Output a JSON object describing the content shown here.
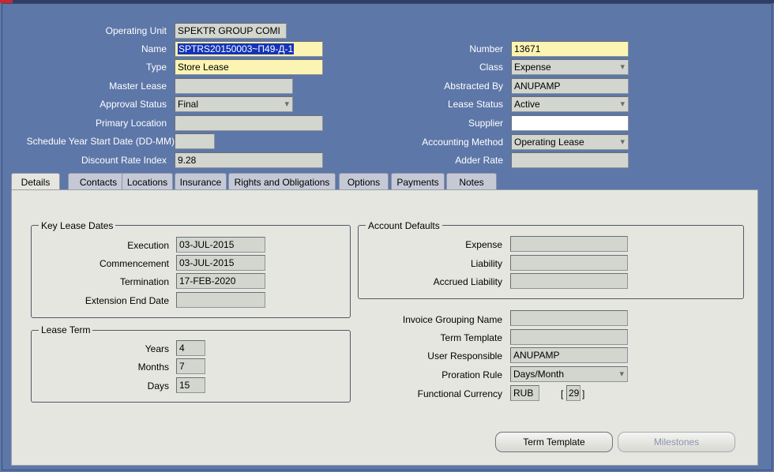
{
  "header": {
    "operating_unit": {
      "label": "Operating Unit",
      "value": "SPEKTR GROUP COMI"
    },
    "name": {
      "label": "Name",
      "value": "SPTRS20150003~П49-Д-1"
    },
    "type": {
      "label": "Type",
      "value": "Store Lease"
    },
    "master_lease": {
      "label": "Master Lease",
      "value": ""
    },
    "approval_status": {
      "label": "Approval Status",
      "value": "Final"
    },
    "primary_location": {
      "label": "Primary Location",
      "value": ""
    },
    "schedule_year_start": {
      "label": "Schedule Year Start Date (DD-MM)",
      "value": ""
    },
    "discount_rate_index": {
      "label": "Discount Rate Index",
      "value": "9.28"
    },
    "number": {
      "label": "Number",
      "value": "13671"
    },
    "class": {
      "label": "Class",
      "value": "Expense"
    },
    "abstracted_by": {
      "label": "Abstracted By",
      "value": "ANUPAMP"
    },
    "lease_status": {
      "label": "Lease Status",
      "value": "Active"
    },
    "supplier": {
      "label": "Supplier",
      "value": ""
    },
    "accounting_method": {
      "label": "Accounting Method",
      "value": "Operating Lease"
    },
    "adder_rate": {
      "label": "Adder Rate",
      "value": ""
    }
  },
  "tabs": [
    {
      "label": "Details"
    },
    {
      "label": "Contacts"
    },
    {
      "label": "Locations"
    },
    {
      "label": "Insurance"
    },
    {
      "label": "Rights and Obligations"
    },
    {
      "label": "Options"
    },
    {
      "label": "Payments"
    },
    {
      "label": "Notes"
    }
  ],
  "key_lease_dates": {
    "title": "Key Lease Dates",
    "execution": {
      "label": "Execution",
      "value": "03-JUL-2015"
    },
    "commencement": {
      "label": "Commencement",
      "value": "03-JUL-2015"
    },
    "termination": {
      "label": "Termination",
      "value": "17-FEB-2020"
    },
    "extension_end_date": {
      "label": "Extension End Date",
      "value": ""
    }
  },
  "lease_term": {
    "title": "Lease Term",
    "years": {
      "label": "Years",
      "value": "4"
    },
    "months": {
      "label": "Months",
      "value": "7"
    },
    "days": {
      "label": "Days",
      "value": "15"
    }
  },
  "account_defaults": {
    "title": "Account Defaults",
    "expense": {
      "label": "Expense",
      "value": ""
    },
    "liability": {
      "label": "Liability",
      "value": ""
    },
    "accrued_liability": {
      "label": "Accrued Liability",
      "value": ""
    }
  },
  "misc": {
    "invoice_grouping_name": {
      "label": "Invoice Grouping Name",
      "value": ""
    },
    "term_template": {
      "label": "Term Template",
      "value": ""
    },
    "user_responsible": {
      "label": "User Responsible",
      "value": "ANUPAMP"
    },
    "proration_rule": {
      "label": "Proration Rule",
      "value": "Days/Month"
    },
    "functional_currency": {
      "label": "Functional Currency",
      "value": "RUB",
      "bracket_open": "[",
      "bracket_value": "29",
      "bracket_close": "]"
    }
  },
  "buttons": {
    "term_template": "Term Template",
    "milestones": "Milestones"
  },
  "colors": {
    "window_bg": "#5d77a8",
    "panel_bg": "#e6e6e0",
    "required_field": "#fbf4b3",
    "selection": "#1533b8"
  }
}
